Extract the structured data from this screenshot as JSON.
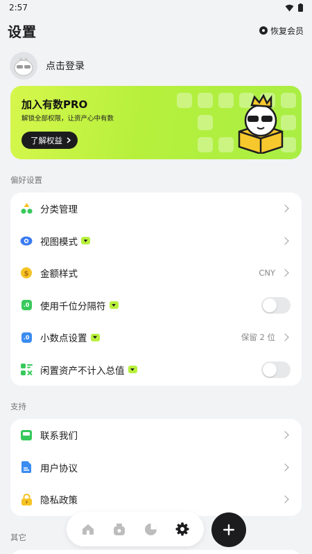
{
  "status": {
    "time": "2:57"
  },
  "header": {
    "title": "设置",
    "restore_label": "恢复会员"
  },
  "login": {
    "text": "点击登录"
  },
  "pro": {
    "title": "加入有数PRO",
    "subtitle": "解锁全部权限，让资产心中有数",
    "button_label": "了解权益"
  },
  "preferences": {
    "section_label": "偏好设置",
    "items": [
      {
        "label": "分类管理",
        "icon": "category-icon"
      },
      {
        "label": "视图模式",
        "icon": "eye-icon",
        "vip": true
      },
      {
        "label": "金额样式",
        "icon": "dollar-icon",
        "value": "CNY"
      },
      {
        "label": "使用千位分隔符",
        "icon": "thousands-icon",
        "vip": true,
        "toggle": false
      },
      {
        "label": "小数点设置",
        "icon": "decimal-icon",
        "vip": true,
        "value": "保留 2 位"
      },
      {
        "label": "闲置资产不计入总值",
        "icon": "idle-assets-icon",
        "vip": true,
        "toggle": false
      }
    ]
  },
  "support": {
    "section_label": "支持",
    "items": [
      {
        "label": "联系我们",
        "icon": "contact-icon"
      },
      {
        "label": "用户协议",
        "icon": "document-icon"
      },
      {
        "label": "隐私政策",
        "icon": "lock-icon"
      }
    ]
  },
  "other": {
    "section_label": "其它"
  },
  "nav": {
    "items": [
      "home-icon",
      "assets-icon",
      "stats-icon",
      "settings-icon"
    ],
    "active": "settings-icon"
  },
  "colors": {
    "accent": "#b8f03c",
    "dark": "#1c1c1e",
    "background": "#f2f3f5"
  }
}
